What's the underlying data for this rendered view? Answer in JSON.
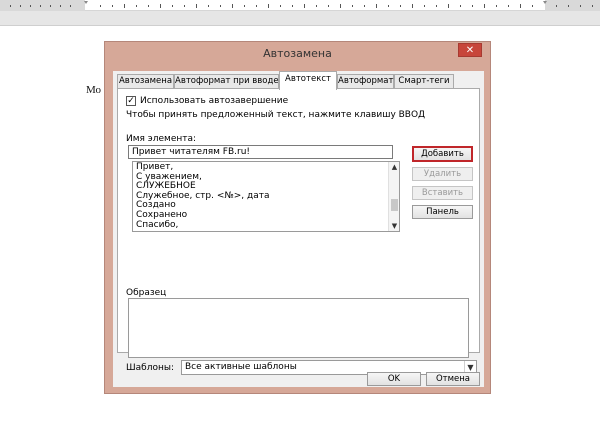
{
  "dialog": {
    "title": "Автозамена",
    "close_icon": "close-icon",
    "tabs": [
      {
        "label": "Автозамена",
        "active": false
      },
      {
        "label": "Автоформат при вводе",
        "active": false
      },
      {
        "label": "Автотекст",
        "active": true
      },
      {
        "label": "Автоформат",
        "active": false
      },
      {
        "label": "Смарт-теги",
        "active": false
      }
    ],
    "use_autocomplete": {
      "label": "Использовать автозавершение",
      "checked": true,
      "mark": "✓"
    },
    "hint": "Чтобы принять предложенный текст, нажмите клавишу ВВОД",
    "name_label": "Имя элемента:",
    "name_value": "Привет читателям FB.ru!",
    "entries": [
      "Привет,",
      "С уважением,",
      "СЛУЖЕБНОЕ",
      "Служебное, стр. <№>, дата",
      "Создано",
      "Сохранено",
      "Спасибо,"
    ],
    "buttons": {
      "add": "Добавить",
      "delete": "Удалить",
      "insert": "Вставить",
      "toolbar": "Панель"
    },
    "sample_label": "Образец",
    "templates_label": "Шаблоны:",
    "templates_value": "Все активные шаблоны",
    "ok": "OK",
    "cancel": "Отмена"
  },
  "document": {
    "visible_text": "Мо"
  },
  "colors": {
    "dialog_frame": "#d6a898",
    "close": "#c7463b",
    "add_highlight": "#c0262a"
  }
}
